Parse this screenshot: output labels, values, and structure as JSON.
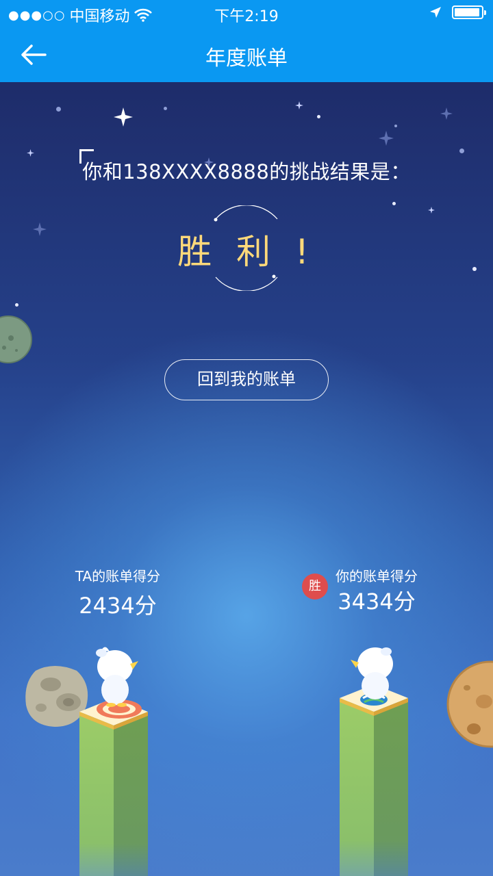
{
  "status_bar": {
    "signal": "●●●○○",
    "carrier": "中国移动",
    "time": "下午2:19"
  },
  "nav": {
    "title": "年度账单",
    "back_icon": "arrow-left-icon"
  },
  "challenge": {
    "text": "你和138XXXX8888的挑战结果是：",
    "result": "胜 利 !"
  },
  "back_button": {
    "label": "回到我的账单"
  },
  "scores": {
    "opponent": {
      "label": "TA的账单得分",
      "value": "2434分"
    },
    "you": {
      "label": "你的账单得分",
      "value": "3434分",
      "badge": "胜"
    }
  },
  "colors": {
    "nav_blue": "#0a98f2",
    "result_gold": "#ffd97a",
    "win_badge": "#de4d4d"
  }
}
